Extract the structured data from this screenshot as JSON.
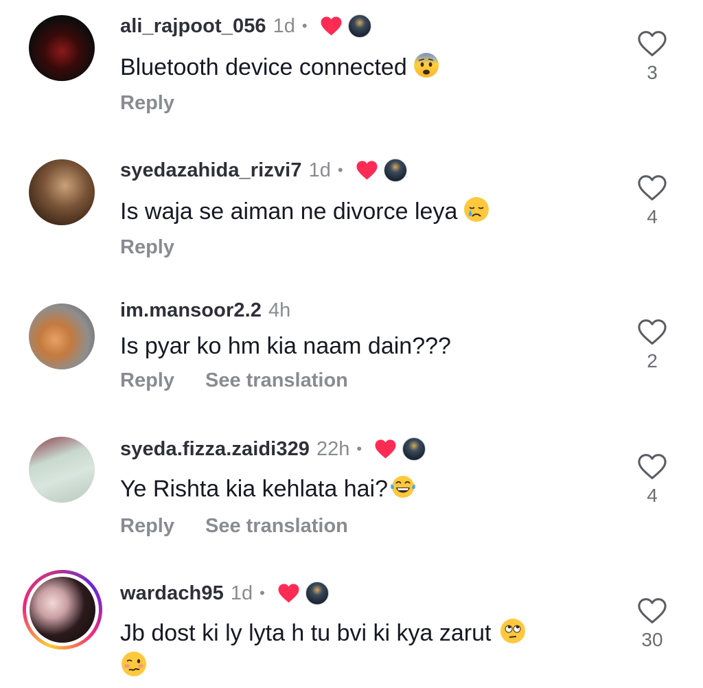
{
  "comments": [
    {
      "username": "ali_rajpoot_056",
      "time": "1d",
      "separator": "•",
      "liked_by_creator": true,
      "text": "Bluetooth device connected",
      "emoji": "anxious-face-with-sweat",
      "actions": {
        "reply": "Reply"
      },
      "likes": "3"
    },
    {
      "username": "syedazahida_rizvi7",
      "time": "1d",
      "separator": "•",
      "liked_by_creator": true,
      "text": "Is waja se aiman ne divorce leya",
      "emoji": "crying-face",
      "actions": {
        "reply": "Reply"
      },
      "likes": "4"
    },
    {
      "username": "im.mansoor2.2",
      "time": "4h",
      "liked_by_creator": false,
      "text": "Is pyar ko hm kia naam dain???",
      "actions": {
        "reply": "Reply",
        "translate": "See translation"
      },
      "likes": "2"
    },
    {
      "username": "syeda.fizza.zaidi329",
      "time": "22h",
      "separator": "•",
      "liked_by_creator": true,
      "text": "Ye Rishta kia kehlata hai?",
      "emoji": "face-with-tears-of-joy",
      "actions": {
        "reply": "Reply",
        "translate": "See translation"
      },
      "likes": "4"
    },
    {
      "username": "wardach95",
      "time": "1d",
      "separator": "•",
      "liked_by_creator": true,
      "text": "Jb dost ki ly lyta h tu bvi ki kya zarut",
      "emoji": "face-with-rolling-eyes",
      "emoji2": "woozy-face",
      "likes": "30"
    }
  ],
  "colors": {
    "username": "#2f2f38",
    "meta": "#8a8b91",
    "text": "#161823",
    "creator_heart": "#fe2c55",
    "like_outline": "#5b5c63"
  }
}
